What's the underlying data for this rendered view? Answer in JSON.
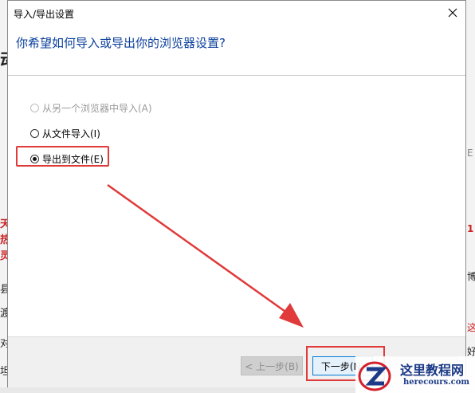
{
  "dialog": {
    "title": "导入/导出设置",
    "question": "你希望如何导入或导出你的浏览器设置?",
    "options": [
      {
        "label": "从另一个浏览器中导入(A)",
        "state": "disabled"
      },
      {
        "label": "从文件导入(I)",
        "state": "unchecked"
      },
      {
        "label": "导出到文件(E)",
        "state": "checked"
      }
    ],
    "buttons": {
      "back": "< 上一步(B)",
      "next": "下一步(N)",
      "cancel": ""
    }
  },
  "background": {
    "left_fragments": [
      "动",
      "天",
      "热",
      "灵",
      "县",
      "渡",
      "对",
      "坦"
    ],
    "right_fragments": [
      "E",
      "1",
      "博",
      "这",
      "好"
    ]
  },
  "watermark": {
    "name": "这里教程网",
    "site": "herecours.com"
  },
  "colors": {
    "accent_blue": "#0078d7",
    "question_blue": "#0a3f9c",
    "annotation_red": "#e03a3a"
  }
}
